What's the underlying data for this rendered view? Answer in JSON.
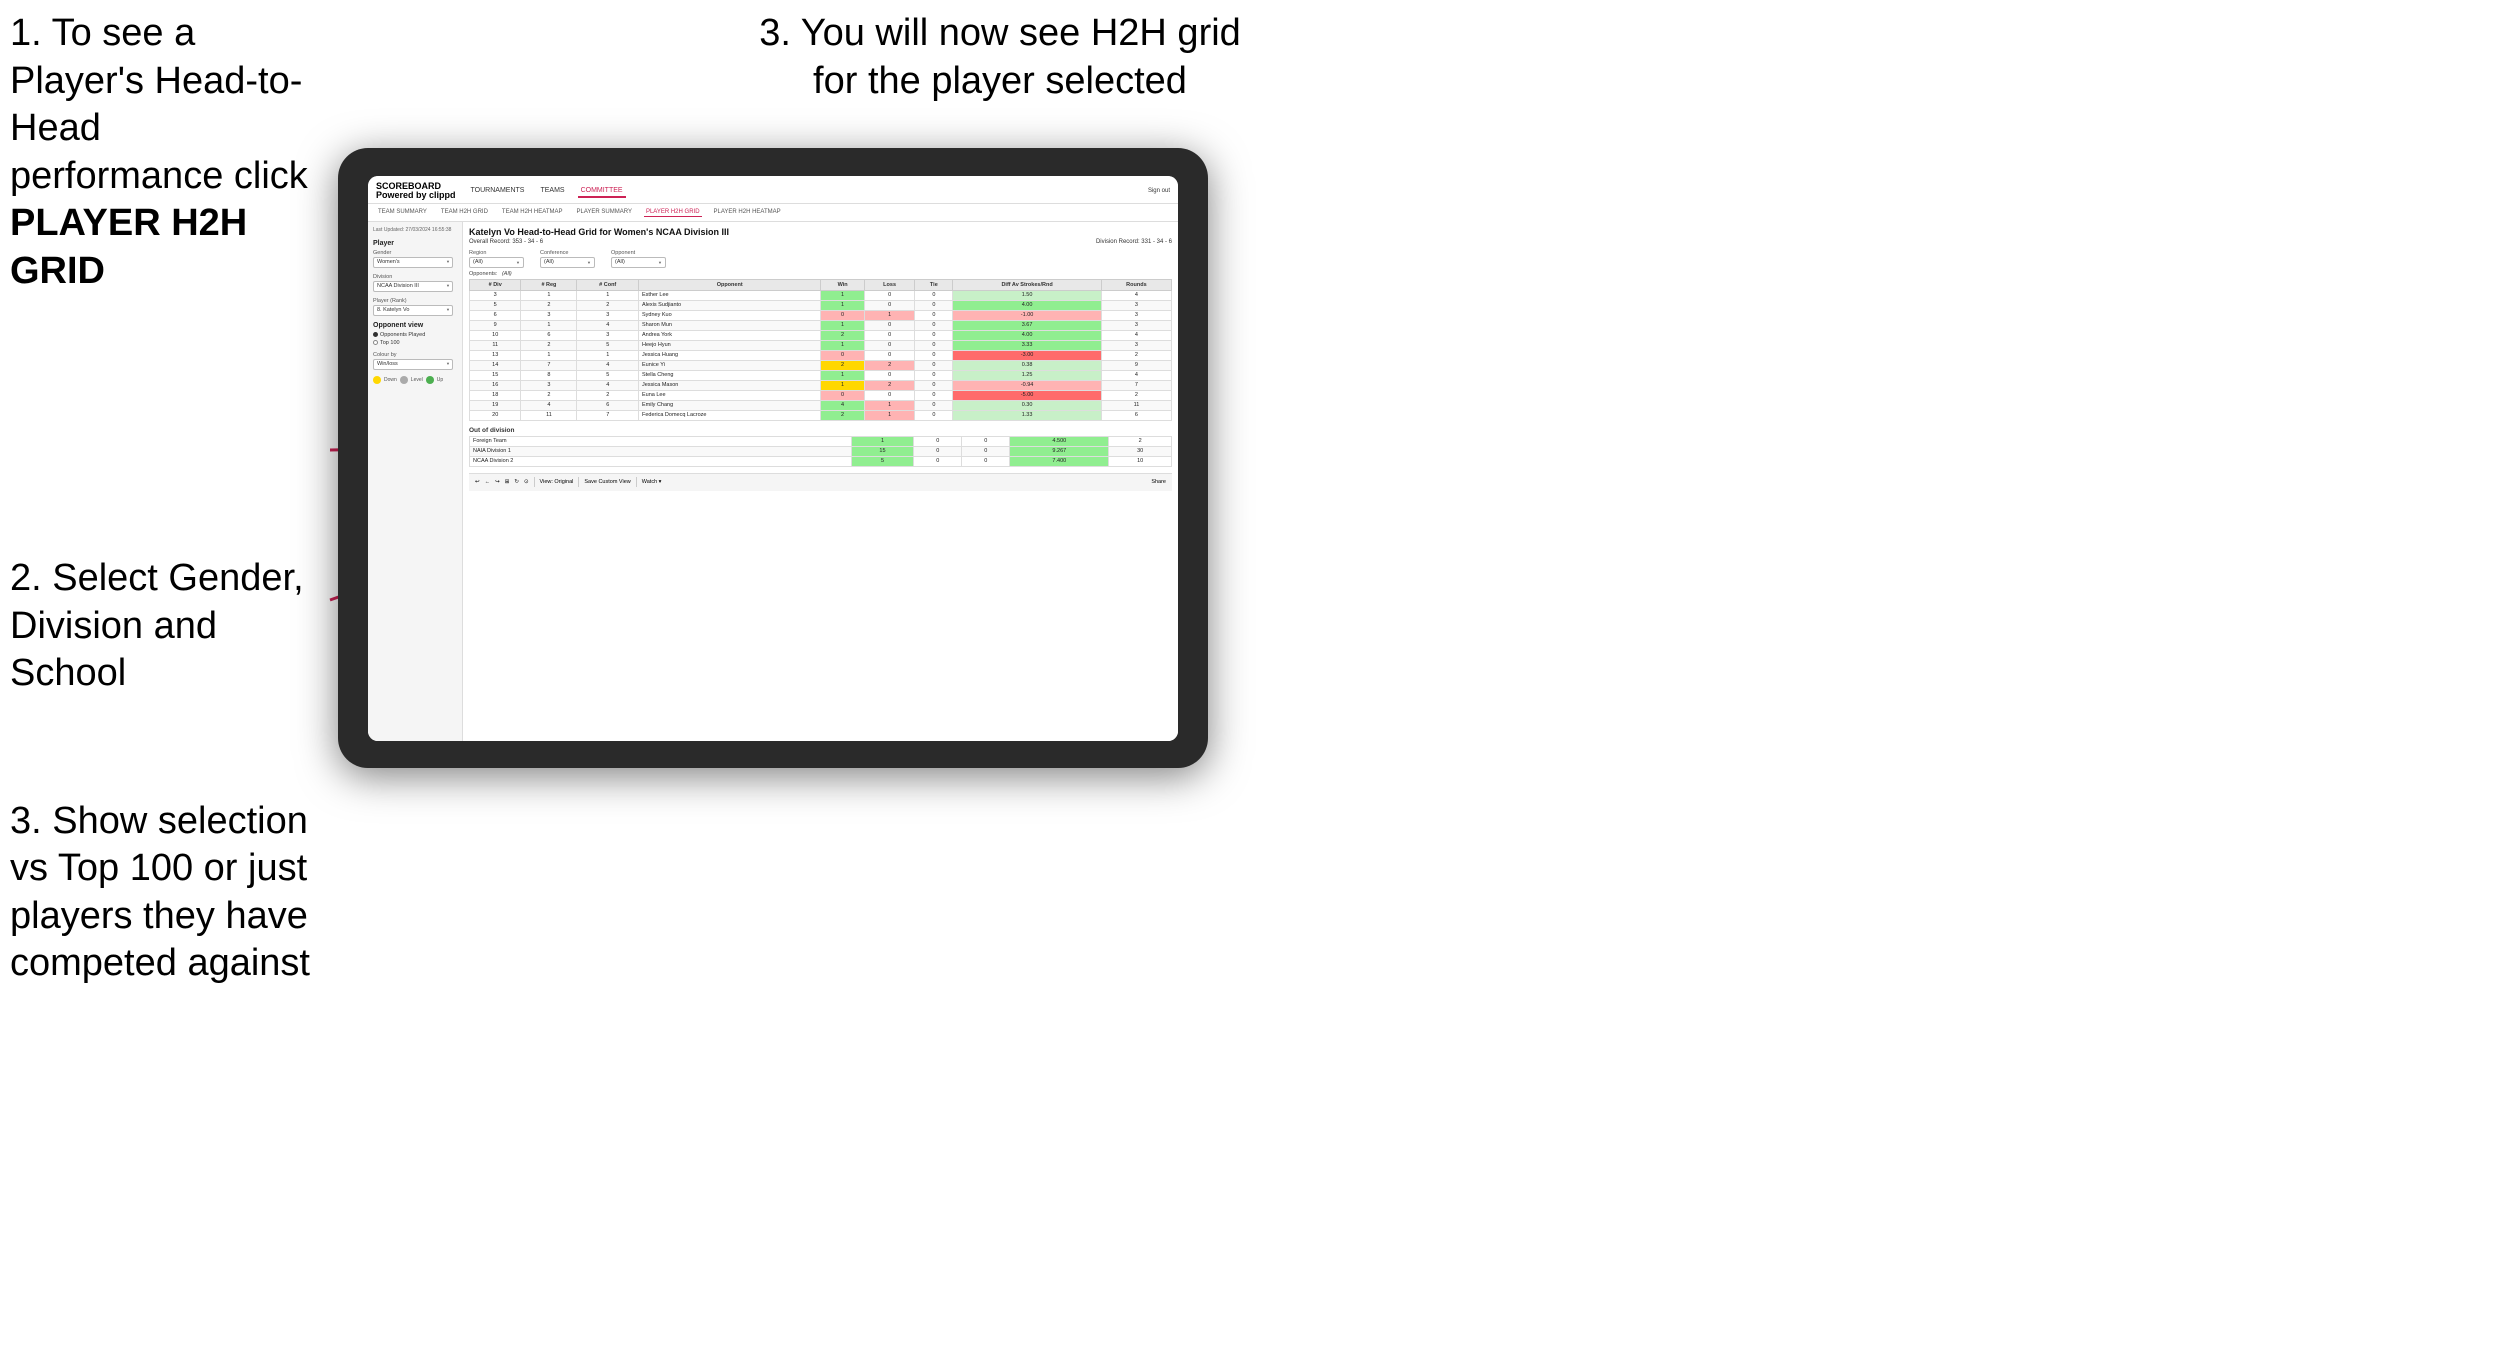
{
  "instructions": {
    "step1": "1. To see a Player's Head-to-Head performance click",
    "step1_bold": "PLAYER H2H GRID",
    "step2": "2. Select Gender, Division and School",
    "step3_left": "3. Show selection vs Top 100 or just players they have competed against",
    "step3_right": "3. You will now see H2H grid for the player selected"
  },
  "nav": {
    "logo": "SCOREBOARD",
    "powered": "Powered by clippd",
    "links": [
      "TOURNAMENTS",
      "TEAMS",
      "COMMITTEE"
    ],
    "active_link": "COMMITTEE",
    "sign_out": "Sign out"
  },
  "sub_nav": {
    "items": [
      "TEAM SUMMARY",
      "TEAM H2H GRID",
      "TEAM H2H HEATMAP",
      "PLAYER SUMMARY",
      "PLAYER H2H GRID",
      "PLAYER H2H HEATMAP"
    ],
    "active": "PLAYER H2H GRID"
  },
  "left_panel": {
    "last_updated": "Last Updated: 27/03/2024\n16:55:38",
    "player_label": "Player",
    "gender_label": "Gender",
    "gender_value": "Women's",
    "division_label": "Division",
    "division_value": "NCAA Division III",
    "player_rank_label": "Player (Rank)",
    "player_rank_value": "8. Katelyn Vo",
    "opponent_view_label": "Opponent view",
    "radio_opponents": "Opponents Played",
    "radio_top100": "Top 100",
    "colour_by_label": "Colour by",
    "colour_by_value": "Win/loss",
    "legend_down": "Down",
    "legend_level": "Level",
    "legend_up": "Up"
  },
  "grid": {
    "title": "Katelyn Vo Head-to-Head Grid for Women's NCAA Division III",
    "overall_record": "Overall Record: 353 - 34 - 6",
    "division_record": "Division Record: 331 - 34 - 6",
    "region_label": "Region",
    "conference_label": "Conference",
    "opponent_label": "Opponent",
    "opponents_label": "Opponents:",
    "filter_all": "(All)",
    "headers": [
      "# Div",
      "# Reg",
      "# Conf",
      "Opponent",
      "Win",
      "Loss",
      "Tie",
      "Diff Av Strokes/Rnd",
      "Rounds"
    ],
    "rows": [
      {
        "div": 3,
        "reg": 1,
        "conf": 1,
        "opponent": "Esther Lee",
        "win": 1,
        "loss": 0,
        "tie": 0,
        "diff": 1.5,
        "rounds": 4,
        "win_color": "green"
      },
      {
        "div": 5,
        "reg": 2,
        "conf": 2,
        "opponent": "Alexis Sudjianto",
        "win": 1,
        "loss": 0,
        "tie": 0,
        "diff": 4.0,
        "rounds": 3,
        "win_color": "green"
      },
      {
        "div": 6,
        "reg": 3,
        "conf": 3,
        "opponent": "Sydney Kuo",
        "win": 0,
        "loss": 1,
        "tie": 0,
        "diff": -1.0,
        "rounds": 3,
        "win_color": "red"
      },
      {
        "div": 9,
        "reg": 1,
        "conf": 4,
        "opponent": "Sharon Mun",
        "win": 1,
        "loss": 0,
        "tie": 0,
        "diff": 3.67,
        "rounds": 3,
        "win_color": "green"
      },
      {
        "div": 10,
        "reg": 6,
        "conf": 3,
        "opponent": "Andrea York",
        "win": 2,
        "loss": 0,
        "tie": 0,
        "diff": 4.0,
        "rounds": 4,
        "win_color": "green"
      },
      {
        "div": 11,
        "reg": 2,
        "conf": 5,
        "opponent": "Heejo Hyun",
        "win": 1,
        "loss": 0,
        "tie": 0,
        "diff": 3.33,
        "rounds": 3,
        "win_color": "green"
      },
      {
        "div": 13,
        "reg": 1,
        "conf": 1,
        "opponent": "Jessica Huang",
        "win": 0,
        "loss": 0,
        "tie": 0,
        "diff": -3.0,
        "rounds": 2,
        "win_color": "red"
      },
      {
        "div": 14,
        "reg": 7,
        "conf": 4,
        "opponent": "Eunice Yi",
        "win": 2,
        "loss": 2,
        "tie": 0,
        "diff": 0.38,
        "rounds": 9,
        "win_color": "yellow"
      },
      {
        "div": 15,
        "reg": 8,
        "conf": 5,
        "opponent": "Stella Cheng",
        "win": 1,
        "loss": 0,
        "tie": 0,
        "diff": 1.25,
        "rounds": 4,
        "win_color": "green"
      },
      {
        "div": 16,
        "reg": 3,
        "conf": 4,
        "opponent": "Jessica Mason",
        "win": 1,
        "loss": 2,
        "tie": 0,
        "diff": -0.94,
        "rounds": 7,
        "win_color": "yellow"
      },
      {
        "div": 18,
        "reg": 2,
        "conf": 2,
        "opponent": "Euna Lee",
        "win": 0,
        "loss": 0,
        "tie": 0,
        "diff": -5.0,
        "rounds": 2,
        "win_color": "red"
      },
      {
        "div": 19,
        "reg": 4,
        "conf": 6,
        "opponent": "Emily Chang",
        "win": 4,
        "loss": 1,
        "tie": 0,
        "diff": 0.3,
        "rounds": 11,
        "win_color": "green"
      },
      {
        "div": 20,
        "reg": 11,
        "conf": 7,
        "opponent": "Federica Domecq Lacroze",
        "win": 2,
        "loss": 1,
        "tie": 0,
        "diff": 1.33,
        "rounds": 6,
        "win_color": "green"
      }
    ],
    "out_of_division_title": "Out of division",
    "out_of_division_rows": [
      {
        "name": "Foreign Team",
        "win": 1,
        "loss": 0,
        "tie": 0,
        "diff": 4.5,
        "rounds": 2
      },
      {
        "name": "NAIA Division 1",
        "win": 15,
        "loss": 0,
        "tie": 0,
        "diff": 9.267,
        "rounds": 30
      },
      {
        "name": "NCAA Division 2",
        "win": 5,
        "loss": 0,
        "tie": 0,
        "diff": 7.4,
        "rounds": 10
      }
    ]
  },
  "toolbar": {
    "buttons": [
      "↩",
      "←",
      "↪",
      "⊞",
      "↻ ·",
      "⊙"
    ],
    "view_original": "View: Original",
    "save_custom": "Save Custom View",
    "watch": "Watch ▾",
    "share": "Share"
  }
}
